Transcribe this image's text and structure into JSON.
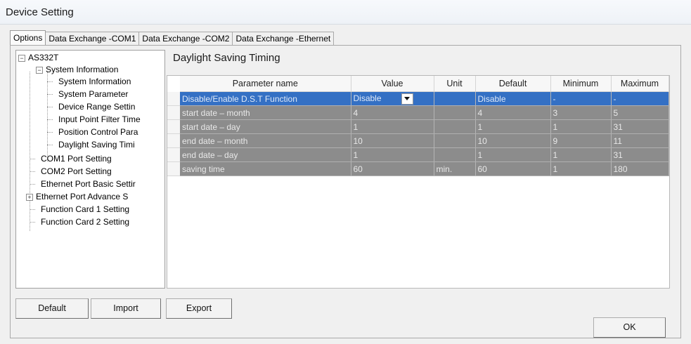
{
  "window": {
    "title": "Device Setting"
  },
  "tabs": [
    {
      "label": "Options"
    },
    {
      "label": "Data Exchange -COM1"
    },
    {
      "label": "Data Exchange -COM2"
    },
    {
      "label": "Data Exchange -Ethernet"
    }
  ],
  "tree": {
    "root": "AS332T",
    "system_information": "System Information",
    "children": [
      "System Information",
      "System Parameter",
      "Device Range Settin",
      "Input Point Filter Time",
      "Position Control Para",
      "Daylight Saving Timi"
    ],
    "com1": "COM1 Port Setting",
    "com2": "COM2 Port Setting",
    "eth_basic": "Ethernet Port Basic Settir",
    "eth_advance": "Ethernet Port Advance S",
    "card1": "Function Card 1 Setting",
    "card2": "Function Card 2 Setting"
  },
  "section_title": "Daylight Saving Timing",
  "grid": {
    "headers": [
      "Parameter name",
      "Value",
      "Unit",
      "Default",
      "Minimum",
      "Maximum"
    ],
    "rows": [
      {
        "name": "Disable/Enable D.S.T Function",
        "value": "Disable",
        "unit": "",
        "default": "Disable",
        "min": "-",
        "max": "-"
      },
      {
        "name": "start date – month",
        "value": "4",
        "unit": "",
        "default": "4",
        "min": "3",
        "max": "5"
      },
      {
        "name": "start date – day",
        "value": "1",
        "unit": "",
        "default": "1",
        "min": "1",
        "max": "31"
      },
      {
        "name": "end date – month",
        "value": "10",
        "unit": "",
        "default": "10",
        "min": "9",
        "max": "11"
      },
      {
        "name": "end date – day",
        "value": "1",
        "unit": "",
        "default": "1",
        "min": "1",
        "max": "31"
      },
      {
        "name": "saving time",
        "value": "60",
        "unit": "min.",
        "default": "60",
        "min": "1",
        "max": "180"
      }
    ]
  },
  "buttons": {
    "default": "Default",
    "import": "Import",
    "export": "Export",
    "ok": "OK"
  },
  "icons": {
    "collapse": "minus-box-icon",
    "expand": "plus-box-icon",
    "dropdown": "chevron-down-icon"
  }
}
